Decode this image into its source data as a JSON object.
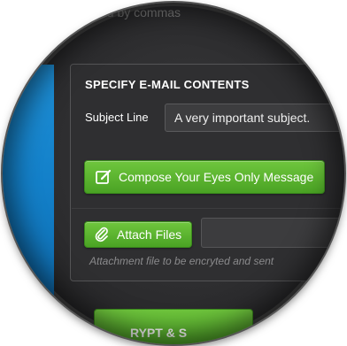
{
  "recipients": {
    "hint_text": "ed by commas"
  },
  "email_contents": {
    "section_title": "SPECIFY E-MAIL CONTENTS",
    "subject_label": "Subject Line",
    "subject_value": "A very important subject.",
    "compose_button_label": "Compose Your Eyes Only Message",
    "compose_icon": "compose-edit-icon",
    "attach_button_label": "Attach Files",
    "attach_icon": "paperclip-icon",
    "attach_field_value": "",
    "attachment_help": "Attachment file to be encryted and sent"
  },
  "submit": {
    "label": "RYPT & S"
  },
  "colors": {
    "accent_green": "#4aa324",
    "side_panel_blue": "#1380c9",
    "panel_background": "#2f2f31"
  }
}
